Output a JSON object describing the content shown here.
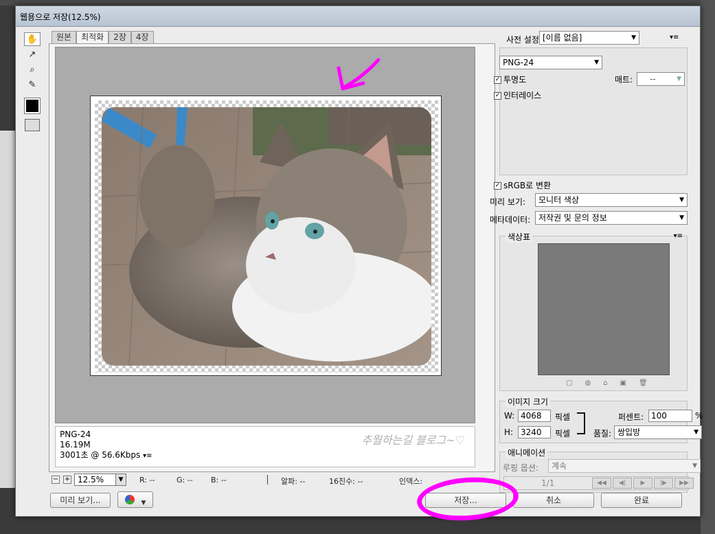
{
  "window": {
    "title": "웹용으로 저장(12.5%)"
  },
  "tools": [
    {
      "name": "hand-tool-icon",
      "glyph": "✋"
    },
    {
      "name": "slice-select-tool-icon",
      "glyph": "↗"
    },
    {
      "name": "zoom-tool-icon",
      "glyph": "🔍"
    },
    {
      "name": "eyedropper-tool-icon",
      "glyph": "✎"
    }
  ],
  "tabs": [
    "원본",
    "최적화",
    "2장",
    "4장"
  ],
  "preview_info": {
    "format": "PNG-24",
    "size": "16.19M",
    "time": "3001초 @ 56.6Kbps",
    "menu": "▾≡",
    "watermark": "추월하는길 블로그~♡"
  },
  "zoom": {
    "minus": "−",
    "plus": "+",
    "value": "12.5%",
    "r": "R: --",
    "g": "G: --",
    "b": "B: --",
    "alpha": "알파: --",
    "hex": "16진수: --",
    "index": "인덱스:"
  },
  "buttons": {
    "preview": "미리 보기...",
    "save": "저장...",
    "cancel": "취소",
    "done": "완료"
  },
  "settings": {
    "preset_label": "사전 설정:",
    "preset_value": "[이름 없음]",
    "format_value": "PNG-24",
    "transparency_label": "투명도",
    "transparency_checked": "✓",
    "matte_label": "매트:",
    "matte_value": "--",
    "interlace_label": "인터레이스",
    "interlace_checked": "✓",
    "srgb_label": "sRGB로 변환",
    "srgb_checked": "✓",
    "preview_label": "미리 보기:",
    "preview_value": "모니터 색상",
    "metadata_label": "메타데이터:",
    "metadata_value": "저작권 및 문의 정보",
    "menu_icon": "▾≡"
  },
  "color_table": {
    "title": "색상표"
  },
  "image_size": {
    "title": "이미지 크기",
    "w_label": "W:",
    "w_value": "4068",
    "h_label": "H:",
    "h_value": "3240",
    "unit": "픽셀",
    "percent_label": "퍼센트:",
    "percent_value": "100",
    "percent_sign": "%",
    "quality_label": "품질:",
    "quality_value": "쌍입방"
  },
  "animation": {
    "title": "애니메이션",
    "loop_label": "루핑 옵션:",
    "loop_value": "계속",
    "frame": "1/1"
  },
  "colors": {
    "annotation": "#ff00ff",
    "canvas": "#ababab",
    "dialog": "#ececec"
  }
}
